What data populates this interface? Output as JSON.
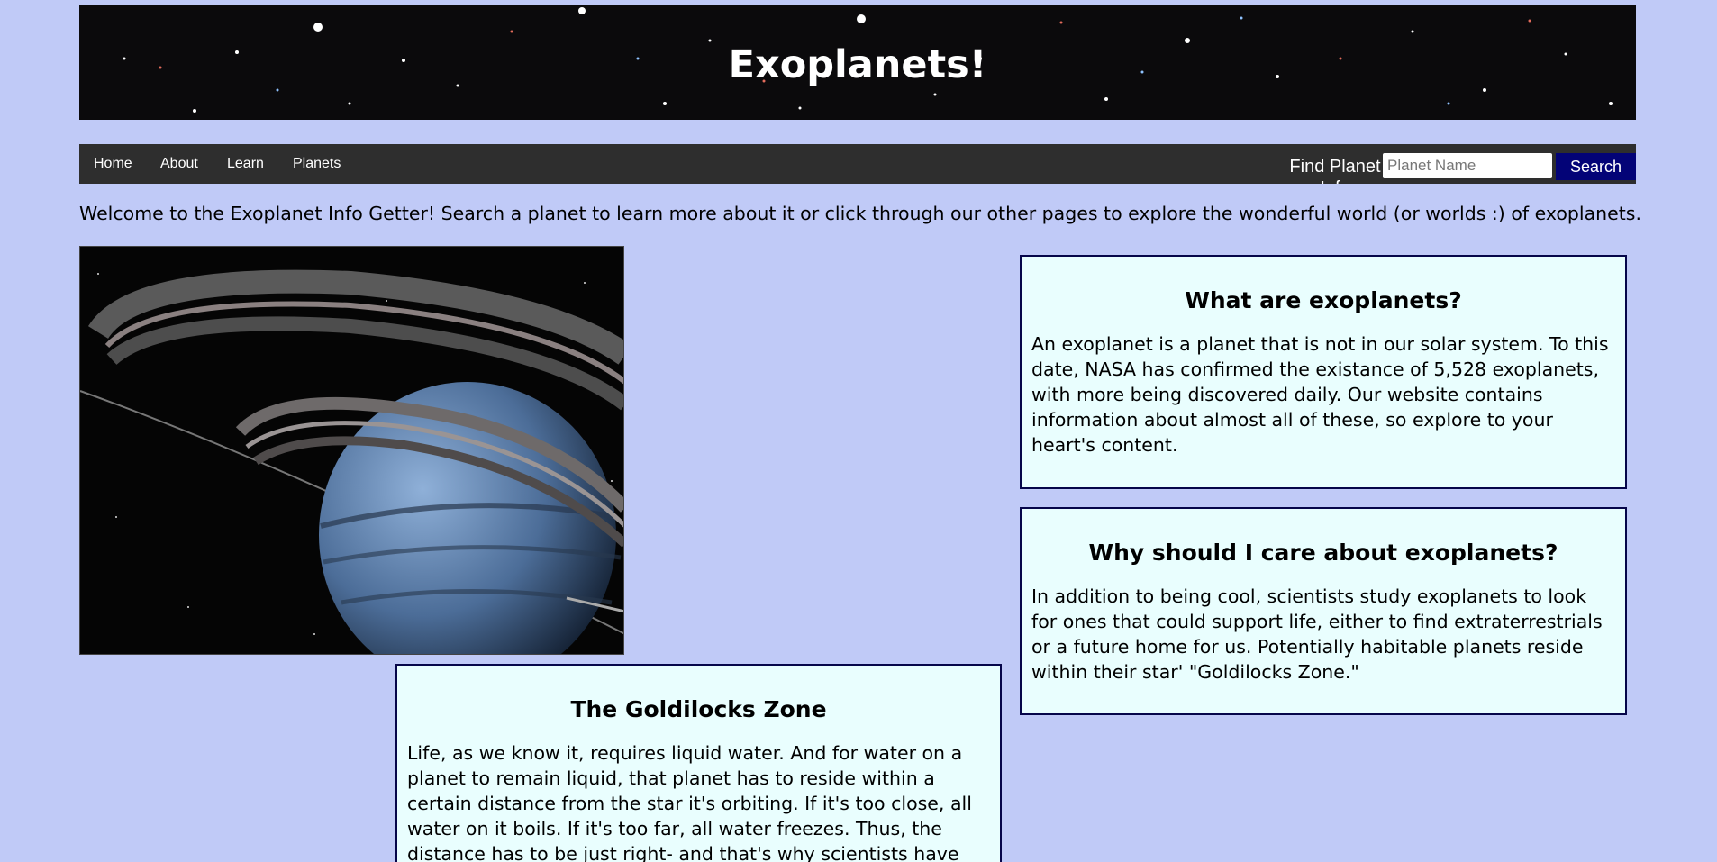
{
  "banner": {
    "title": "Exoplanets!",
    "background_color": "#0b0a0c"
  },
  "nav": {
    "items": [
      {
        "label": "Home"
      },
      {
        "label": "About"
      },
      {
        "label": "Learn"
      },
      {
        "label": "Planets"
      }
    ],
    "find_label": "Find Planet Info",
    "search_placeholder": "Planet Name",
    "search_button": "Search",
    "search_button_color": "#030377"
  },
  "welcome_text": "Welcome to the Exoplanet Info Getter! Search a planet to learn more about it or click through our other pages to explore the wonderful world (or worlds :) of exoplanets.",
  "image": {
    "subject": "ringed-planet-illustration"
  },
  "cards": {
    "what": {
      "heading": "What are exoplanets?",
      "body": "An exoplanet is a planet that is not in our solar system. To this date, NASA has confirmed the existance of 5,528 exoplanets, with more being discovered daily. Our website contains information about almost all of these, so explore to your heart's content."
    },
    "why": {
      "heading": "Why should I care about exoplanets?",
      "body": "In addition to being cool, scientists study exoplanets to look for ones that could support life, either to find extraterrestrials or a future home for us. Potentially habitable planets reside within their star' \"Goldilocks Zone.\""
    },
    "goldilocks": {
      "heading": "The Goldilocks Zone",
      "body": "Life, as we know it, requires liquid water. And for water on a planet to remain liquid, that planet has to reside within a certain distance from the star it's orbiting. If it's too close, all water on it boils. If it's too far, all water freezes. Thus, the distance has to be just right- and that's why scientists have"
    }
  },
  "colors": {
    "page_background": "#c0caf7",
    "card_background": "#e9fefe",
    "card_border": "#06064a",
    "navbar_background": "#2e2e2e"
  }
}
